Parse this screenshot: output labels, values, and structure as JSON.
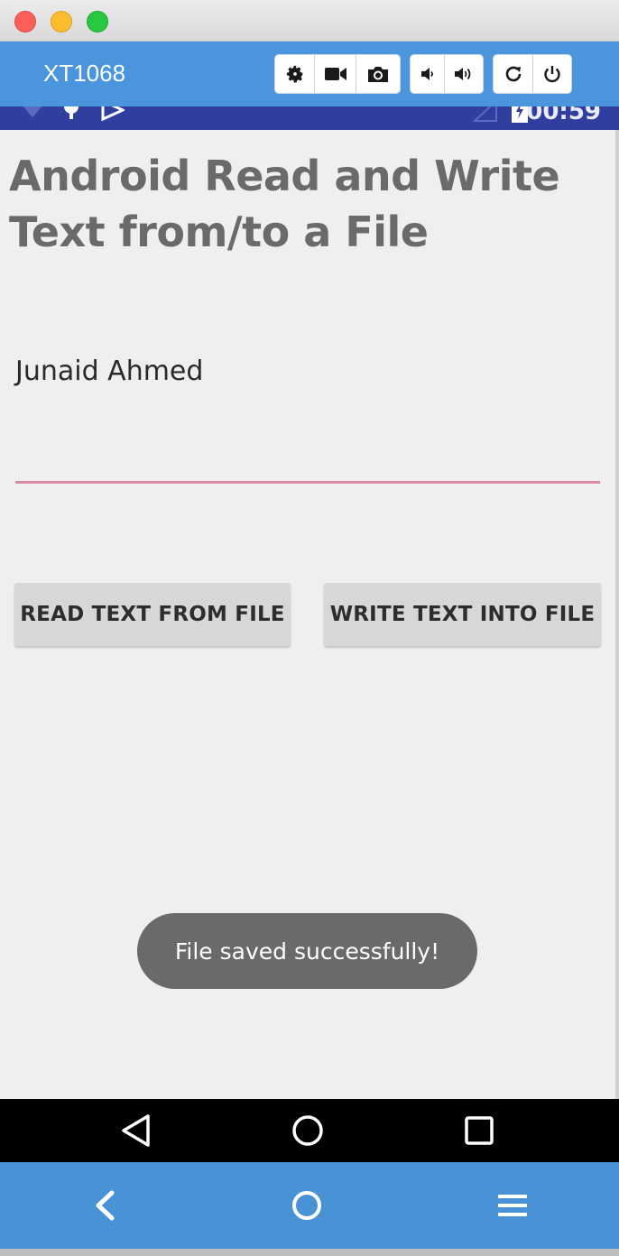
{
  "window": {
    "device_name": "XT1068"
  },
  "toolbar": {
    "icons": [
      "gear-icon",
      "video-camera-icon",
      "camera-icon",
      "volume-down-icon",
      "volume-up-icon",
      "rotate-icon",
      "power-icon"
    ]
  },
  "status_bar": {
    "time": "00:59"
  },
  "app": {
    "title": "Android Read and Write Text from/to a File",
    "text_field_value": "Junaid Ahmed",
    "read_button_label": "READ TEXT FROM FILE",
    "write_button_label": "WRITE TEXT INTO FILE",
    "toast_message": "File saved successfully!"
  },
  "colors": {
    "toolbar_bg": "#4a95db",
    "status_bar_bg": "#303f9f",
    "field_underline": "#d98aa4",
    "toast_bg": "#6a6a6c"
  }
}
